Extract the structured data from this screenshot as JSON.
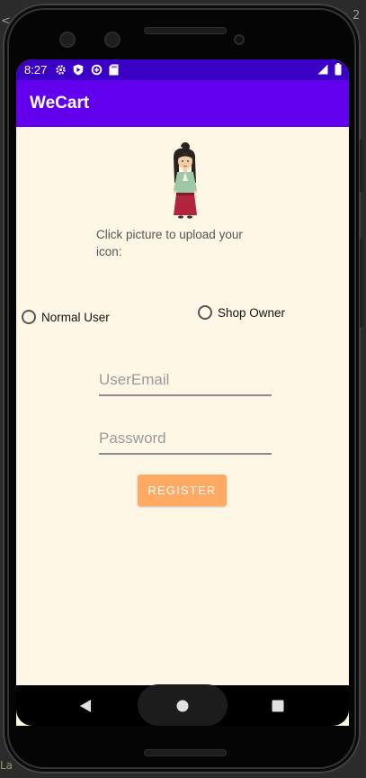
{
  "status_bar": {
    "time": "8:27"
  },
  "app_bar": {
    "title": "WeCart"
  },
  "upload": {
    "hint_line1": "Click picture to upload your",
    "hint_line2": "icon:"
  },
  "roles": [
    {
      "label": "Normal User",
      "selected": false
    },
    {
      "label": "Shop Owner",
      "selected": false
    }
  ],
  "form": {
    "email_placeholder": "UserEmail",
    "email_value": "",
    "password_placeholder": "Password",
    "password_value": ""
  },
  "register_label": "REGISTER",
  "colors": {
    "status_bar": "#3a00c5",
    "app_bar": "#6200ee",
    "screen_background": "#fef7e6",
    "register_button": "#ffaa63"
  },
  "icons": {
    "status": [
      "settings-gear-icon",
      "play-protect-icon",
      "data-saver-icon",
      "sd-card-icon",
      "signal-icon",
      "battery-icon"
    ],
    "nav": [
      "back-icon",
      "home-icon",
      "recents-icon"
    ]
  }
}
